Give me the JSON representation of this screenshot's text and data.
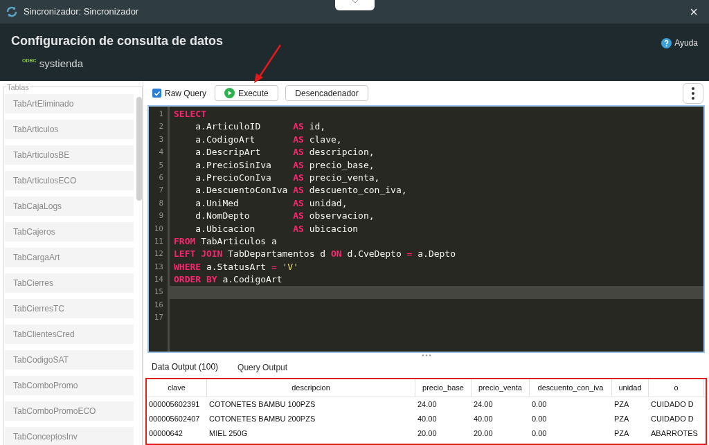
{
  "window": {
    "title": "Sincronizador: Sincronizador",
    "close": "×"
  },
  "header": {
    "title": "Configuración de consulta de datos",
    "help": "Ayuda",
    "source_badge": "ODBC",
    "source_name": "systienda"
  },
  "sidebar": {
    "legend": "Tablas",
    "items": [
      {
        "label": "TabArtEliminado",
        "selected": false
      },
      {
        "label": "TabArticulos",
        "selected": false
      },
      {
        "label": "TabArticulosBE",
        "selected": false
      },
      {
        "label": "TabArticulosECO",
        "selected": false
      },
      {
        "label": "TabCajaLogs",
        "selected": false
      },
      {
        "label": "TabCajeros",
        "selected": false
      },
      {
        "label": "TabCargaArt",
        "selected": false
      },
      {
        "label": "TabCierres",
        "selected": false
      },
      {
        "label": "TabCierresTC",
        "selected": false
      },
      {
        "label": "TabClientesCred",
        "selected": false
      },
      {
        "label": "TabCodigoSAT",
        "selected": false
      },
      {
        "label": "TabComboPromo",
        "selected": false
      },
      {
        "label": "TabComboPromoECO",
        "selected": false
      },
      {
        "label": "TabConceptosInv",
        "selected": false
      }
    ]
  },
  "toolbar": {
    "raw_query": {
      "label": "Raw Query",
      "checked": true
    },
    "buttons": [
      {
        "label": "Execute",
        "kind": "execute"
      },
      {
        "label": "Desencadenador",
        "kind": "plain"
      }
    ]
  },
  "editor": {
    "lines": [
      {
        "number": "1",
        "tokens": [
          {
            "kind": "kw",
            "text": "SELECT"
          }
        ]
      },
      {
        "number": "2",
        "tokens": [
          {
            "kind": "plain",
            "text": "    a.ArticuloID      "
          },
          {
            "kind": "kw",
            "text": "AS"
          },
          {
            "kind": "plain",
            "text": " id,"
          }
        ]
      },
      {
        "number": "3",
        "tokens": [
          {
            "kind": "plain",
            "text": "    a.CodigoArt       "
          },
          {
            "kind": "kw",
            "text": "AS"
          },
          {
            "kind": "plain",
            "text": " clave,"
          }
        ]
      },
      {
        "number": "4",
        "tokens": [
          {
            "kind": "plain",
            "text": "    a.DescripArt      "
          },
          {
            "kind": "kw",
            "text": "AS"
          },
          {
            "kind": "plain",
            "text": " descripcion,"
          }
        ]
      },
      {
        "number": "5",
        "tokens": [
          {
            "kind": "plain",
            "text": "    a.PrecioSinIva    "
          },
          {
            "kind": "kw",
            "text": "AS"
          },
          {
            "kind": "plain",
            "text": " precio_base,"
          }
        ]
      },
      {
        "number": "6",
        "tokens": [
          {
            "kind": "plain",
            "text": "    a.PrecioConIva    "
          },
          {
            "kind": "kw",
            "text": "AS"
          },
          {
            "kind": "plain",
            "text": " precio_venta,"
          }
        ]
      },
      {
        "number": "7",
        "tokens": [
          {
            "kind": "plain",
            "text": "    a.DescuentoConIva "
          },
          {
            "kind": "kw",
            "text": "AS"
          },
          {
            "kind": "plain",
            "text": " descuento_con_iva,"
          }
        ]
      },
      {
        "number": "8",
        "tokens": [
          {
            "kind": "plain",
            "text": "    a.UniMed          "
          },
          {
            "kind": "kw",
            "text": "AS"
          },
          {
            "kind": "plain",
            "text": " unidad,"
          }
        ]
      },
      {
        "number": "9",
        "tokens": [
          {
            "kind": "plain",
            "text": "    d.NomDepto        "
          },
          {
            "kind": "kw",
            "text": "AS"
          },
          {
            "kind": "plain",
            "text": " observacion,"
          }
        ]
      },
      {
        "number": "10",
        "tokens": [
          {
            "kind": "plain",
            "text": "    a.Ubicacion       "
          },
          {
            "kind": "kw",
            "text": "AS"
          },
          {
            "kind": "plain",
            "text": " ubicacion"
          }
        ]
      },
      {
        "number": "11",
        "tokens": [
          {
            "kind": "kw",
            "text": "FROM"
          },
          {
            "kind": "plain",
            "text": " TabArticulos a"
          }
        ]
      },
      {
        "number": "12",
        "tokens": [
          {
            "kind": "kw",
            "text": "LEFT JOIN"
          },
          {
            "kind": "plain",
            "text": " TabDepartamentos d "
          },
          {
            "kind": "kw",
            "text": "ON"
          },
          {
            "kind": "plain",
            "text": " d.CveDepto "
          },
          {
            "kind": "op",
            "text": "="
          },
          {
            "kind": "plain",
            "text": " a.Depto"
          }
        ]
      },
      {
        "number": "13",
        "tokens": [
          {
            "kind": "kw",
            "text": "WHERE"
          },
          {
            "kind": "plain",
            "text": " a.StatusArt "
          },
          {
            "kind": "op",
            "text": "="
          },
          {
            "kind": "str",
            "text": " 'V'"
          }
        ]
      },
      {
        "number": "14",
        "tokens": [
          {
            "kind": "kw",
            "text": "ORDER BY"
          },
          {
            "kind": "plain",
            "text": " a.CodigoArt"
          }
        ]
      },
      {
        "number": "15",
        "current": true
      },
      {
        "number": "16",
        "current": false
      },
      {
        "number": "17",
        "current": false
      }
    ]
  },
  "output_tabs": [
    {
      "label": "Data Output (100)",
      "selected": true
    },
    {
      "label": "Query Output",
      "selected": false
    }
  ],
  "table": {
    "columns": [
      "clave",
      "descripcion",
      "precio_base",
      "precio_venta",
      "descuento_con_iva",
      "unidad",
      "o"
    ],
    "rows": [
      [
        "000005602391",
        "COTONETES BAMBU 100PZS",
        "24.00",
        "24.00",
        "0.00",
        "PZA",
        "CUIDADO D"
      ],
      [
        "000005602407",
        "COTONETES BAMBU 200PZS",
        "40.00",
        "40.00",
        "0.00",
        "PZA",
        "CUIDADO D"
      ],
      [
        "00000642",
        "MIEL 250G",
        "20.00",
        "20.00",
        "0.00",
        "PZA",
        "ABARROTES"
      ]
    ]
  }
}
